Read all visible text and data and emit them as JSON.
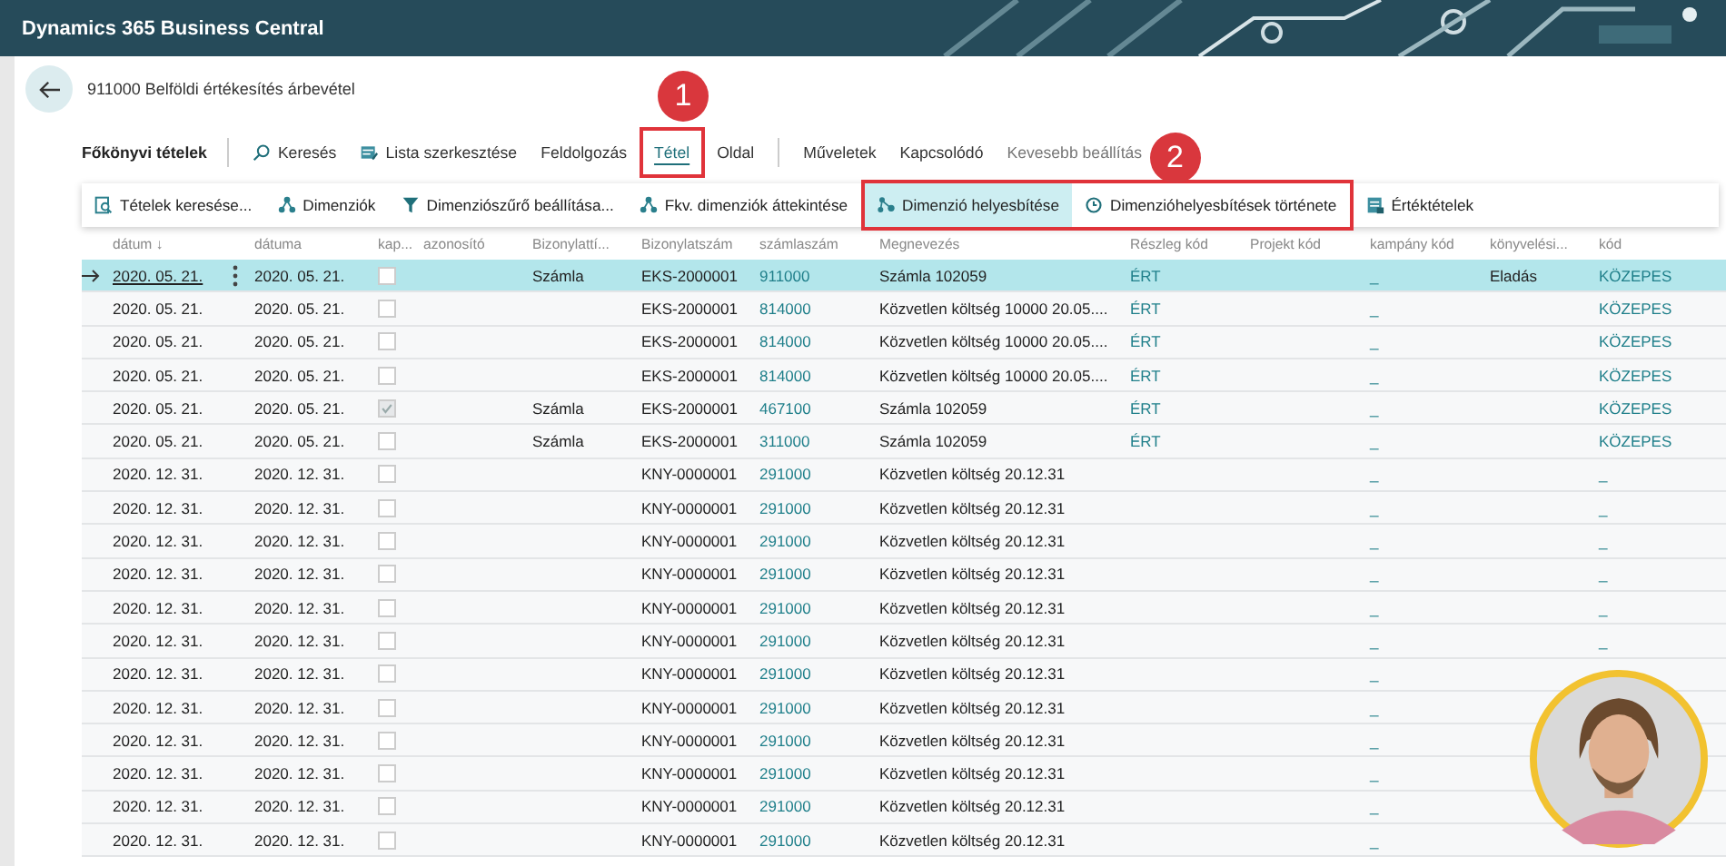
{
  "app_title": "Dynamics 365 Business Central",
  "page_title": "911000 Belföldi értékesítés árbevétel",
  "list_title": "Főkönyvi tételek",
  "action_tabs": [
    {
      "label": "Keresés",
      "kind": "search",
      "selected": false,
      "muted": false
    },
    {
      "label": "Lista szerkesztése",
      "kind": "edit-list",
      "selected": false,
      "muted": false
    },
    {
      "label": "Feldolgozás",
      "selected": false,
      "muted": false
    },
    {
      "label": "Tétel",
      "selected": true,
      "muted": false
    },
    {
      "label": "Oldal",
      "selected": false,
      "muted": false
    },
    {
      "label": "Műveletek",
      "selected": false,
      "muted": false
    },
    {
      "label": "Kapcsolódó",
      "selected": false,
      "muted": false
    },
    {
      "label": "Kevesebb beállítás",
      "selected": false,
      "muted": true
    }
  ],
  "sub_actions": [
    {
      "label": "Tételek keresése...",
      "kind": "find-entries",
      "selected": false
    },
    {
      "label": "Dimenziók",
      "kind": "dimensions",
      "selected": false
    },
    {
      "label": "Dimenziószűrő beállítása...",
      "kind": "filter",
      "selected": false
    },
    {
      "label": "Fkv. dimenziók áttekintése",
      "kind": "dimensions",
      "selected": false
    },
    {
      "label": "Dimenzió helyesbítése",
      "kind": "correct",
      "selected": true
    },
    {
      "label": "Dimenzióhelyesbítések története",
      "kind": "history",
      "selected": false
    },
    {
      "label": "Értéktételek",
      "kind": "value-entries",
      "selected": false
    }
  ],
  "columns": [
    "dátum ↓",
    "dátuma",
    "kap...",
    "azonosító",
    "Bizonylattí...",
    "Bizonylatszám",
    "számlaszám",
    "Megnevezés",
    "Részleg kód",
    "Projekt kód",
    "kampány kód",
    "könyvelési...",
    "kód"
  ],
  "rows": [
    {
      "selected": true,
      "datum": "2020. 05. 21.",
      "datuma": "2020. 05. 21.",
      "checked": false,
      "tipus": "Számla",
      "bizonylat": "EKS-2000001",
      "szamla": "911000",
      "megnevezes": "Számla 102059",
      "reszleg": "ÉRT",
      "kampany": "_",
      "konyvelesi": "Eladás",
      "kod": "KÖZEPES"
    },
    {
      "selected": false,
      "datum": "2020. 05. 21.",
      "datuma": "2020. 05. 21.",
      "checked": false,
      "bizonylat": "EKS-2000001",
      "szamla": "814000",
      "megnevezes": "Közvetlen költség 10000 20.05....",
      "reszleg": "ÉRT",
      "kampany": "_",
      "kod": "KÖZEPES"
    },
    {
      "selected": false,
      "datum": "2020. 05. 21.",
      "datuma": "2020. 05. 21.",
      "checked": false,
      "bizonylat": "EKS-2000001",
      "szamla": "814000",
      "megnevezes": "Közvetlen költség 10000 20.05....",
      "reszleg": "ÉRT",
      "kampany": "_",
      "kod": "KÖZEPES"
    },
    {
      "selected": false,
      "datum": "2020. 05. 21.",
      "datuma": "2020. 05. 21.",
      "checked": false,
      "bizonylat": "EKS-2000001",
      "szamla": "814000",
      "megnevezes": "Közvetlen költség 10000 20.05....",
      "reszleg": "ÉRT",
      "kampany": "_",
      "kod": "KÖZEPES"
    },
    {
      "selected": false,
      "datum": "2020. 05. 21.",
      "datuma": "2020. 05. 21.",
      "checked": true,
      "tipus": "Számla",
      "bizonylat": "EKS-2000001",
      "szamla": "467100",
      "megnevezes": "Számla 102059",
      "reszleg": "ÉRT",
      "kampany": "_",
      "kod": "KÖZEPES"
    },
    {
      "selected": false,
      "datum": "2020. 05. 21.",
      "datuma": "2020. 05. 21.",
      "checked": false,
      "tipus": "Számla",
      "bizonylat": "EKS-2000001",
      "szamla": "311000",
      "megnevezes": "Számla 102059",
      "reszleg": "ÉRT",
      "kampany": "_",
      "kod": "KÖZEPES"
    },
    {
      "selected": false,
      "datum": "2020. 12. 31.",
      "datuma": "2020. 12. 31.",
      "checked": false,
      "bizonylat": "KNY-0000001",
      "szamla": "291000",
      "megnevezes": "Közvetlen költség  20.12.31",
      "kampany": "_",
      "kod": "_"
    },
    {
      "selected": false,
      "datum": "2020. 12. 31.",
      "datuma": "2020. 12. 31.",
      "checked": false,
      "bizonylat": "KNY-0000001",
      "szamla": "291000",
      "megnevezes": "Közvetlen költség  20.12.31",
      "kampany": "_",
      "kod": "_"
    },
    {
      "selected": false,
      "datum": "2020. 12. 31.",
      "datuma": "2020. 12. 31.",
      "checked": false,
      "bizonylat": "KNY-0000001",
      "szamla": "291000",
      "megnevezes": "Közvetlen költség  20.12.31",
      "kampany": "_",
      "kod": "_"
    },
    {
      "selected": false,
      "datum": "2020. 12. 31.",
      "datuma": "2020. 12. 31.",
      "checked": false,
      "bizonylat": "KNY-0000001",
      "szamla": "291000",
      "megnevezes": "Közvetlen költség  20.12.31",
      "kampany": "_",
      "kod": "_"
    },
    {
      "selected": false,
      "datum": "2020. 12. 31.",
      "datuma": "2020. 12. 31.",
      "checked": false,
      "bizonylat": "KNY-0000001",
      "szamla": "291000",
      "megnevezes": "Közvetlen költség  20.12.31",
      "kampany": "_",
      "kod": "_"
    },
    {
      "selected": false,
      "datum": "2020. 12. 31.",
      "datuma": "2020. 12. 31.",
      "checked": false,
      "bizonylat": "KNY-0000001",
      "szamla": "291000",
      "megnevezes": "Közvetlen költség  20.12.31",
      "kampany": "_",
      "kod": "_"
    },
    {
      "selected": false,
      "datum": "2020. 12. 31.",
      "datuma": "2020. 12. 31.",
      "checked": false,
      "bizonylat": "KNY-0000001",
      "szamla": "291000",
      "megnevezes": "Közvetlen költség  20.12.31",
      "kampany": "_"
    },
    {
      "selected": false,
      "datum": "2020. 12. 31.",
      "datuma": "2020. 12. 31.",
      "checked": false,
      "bizonylat": "KNY-0000001",
      "szamla": "291000",
      "megnevezes": "Közvetlen költség  20.12.31",
      "kampany": "_"
    },
    {
      "selected": false,
      "datum": "2020. 12. 31.",
      "datuma": "2020. 12. 31.",
      "checked": false,
      "bizonylat": "KNY-0000001",
      "szamla": "291000",
      "megnevezes": "Közvetlen költség  20.12.31",
      "kampany": "_"
    },
    {
      "selected": false,
      "datum": "2020. 12. 31.",
      "datuma": "2020. 12. 31.",
      "checked": false,
      "bizonylat": "KNY-0000001",
      "szamla": "291000",
      "megnevezes": "Közvetlen költség  20.12.31",
      "kampany": "_"
    },
    {
      "selected": false,
      "datum": "2020. 12. 31.",
      "datuma": "2020. 12. 31.",
      "checked": false,
      "bizonylat": "KNY-0000001",
      "szamla": "291000",
      "megnevezes": "Közvetlen költség  20.12.31",
      "kampany": "_"
    },
    {
      "selected": false,
      "datum": "2020. 12. 31.",
      "datuma": "2020. 12. 31.",
      "checked": false,
      "bizonylat": "KNY-0000001",
      "szamla": "291000",
      "megnevezes": "Közvetlen költség  20.12.31",
      "kampany": "_"
    }
  ],
  "callouts": [
    {
      "label": "1"
    },
    {
      "label": "2"
    }
  ]
}
